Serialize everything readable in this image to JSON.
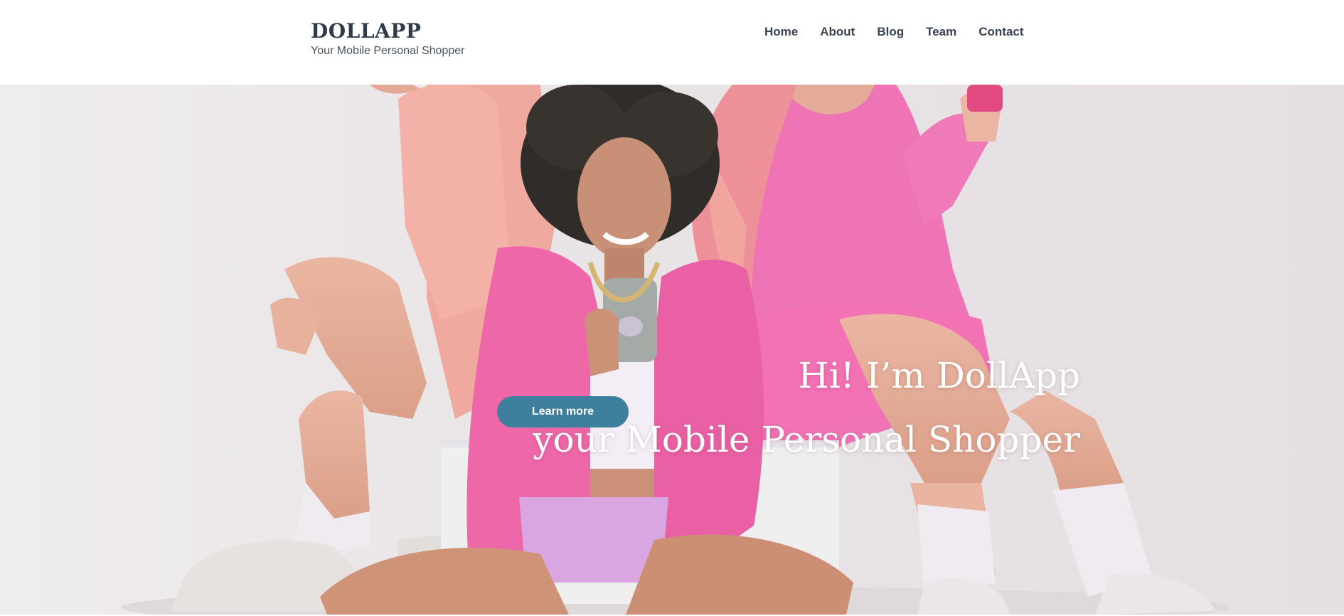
{
  "header": {
    "brand_title": "DOLLAPP",
    "brand_tagline": "Your Mobile Personal Shopper"
  },
  "nav": {
    "items": [
      {
        "label": "Home"
      },
      {
        "label": "About"
      },
      {
        "label": "Blog"
      },
      {
        "label": "Team"
      },
      {
        "label": "Contact"
      }
    ]
  },
  "hero": {
    "heading": "Hi! I’m DollApp",
    "subheading": "your Mobile Personal Shopper",
    "cta_label": "Learn more",
    "image_description_icon": "hero-photo"
  },
  "colors": {
    "brand_text": "#2f3b4b",
    "nav_text": "#3a4352",
    "cta_background": "#3d7f9c",
    "hero_background": "#ece8ea",
    "accent_pink": "#ea5fa6"
  }
}
